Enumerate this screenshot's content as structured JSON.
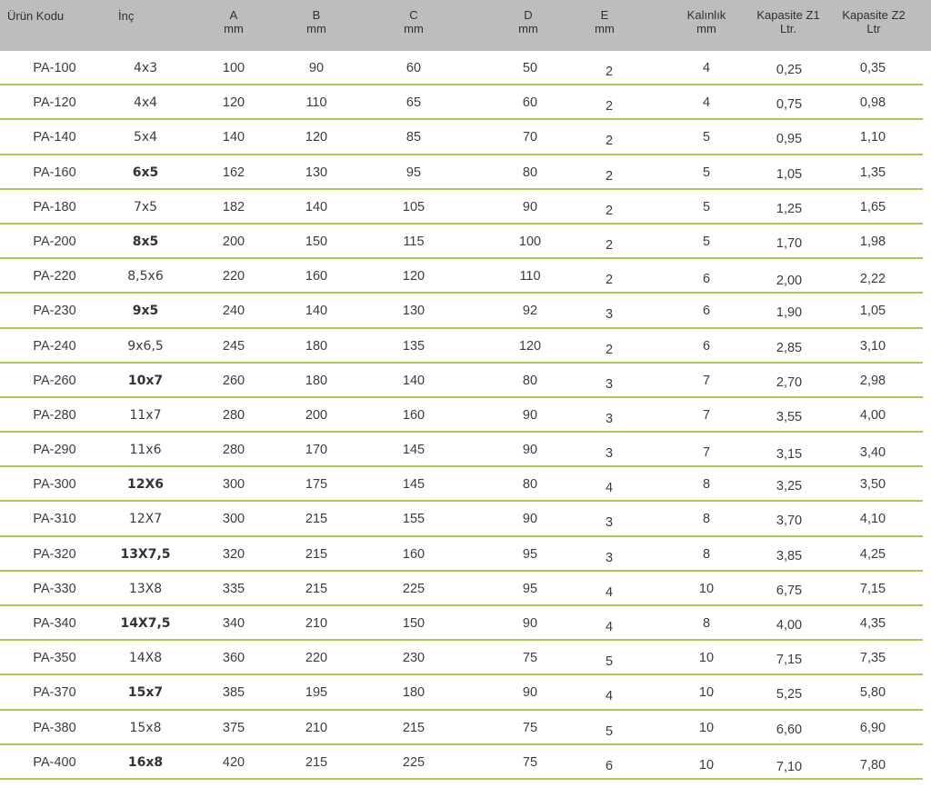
{
  "table": {
    "header": [
      {
        "key": "code",
        "l1": "Ürün Kodu",
        "l2": ""
      },
      {
        "key": "inc",
        "l1": "İnç",
        "l2": ""
      },
      {
        "key": "a",
        "l1": "A",
        "l2": "mm"
      },
      {
        "key": "b",
        "l1": "B",
        "l2": "mm"
      },
      {
        "key": "c",
        "l1": "C",
        "l2": "mm"
      },
      {
        "key": "d",
        "l1": "D",
        "l2": "mm"
      },
      {
        "key": "e",
        "l1": "E",
        "l2": "mm"
      },
      {
        "key": "kal",
        "l1": "Kalınlık",
        "l2": "mm"
      },
      {
        "key": "z1",
        "l1": "Kapasite Z1",
        "l2": "Ltr."
      },
      {
        "key": "z2",
        "l1": "Kapasite Z2",
        "l2": "Ltr"
      }
    ],
    "rows": [
      {
        "code": "PA-100",
        "inc": "4x3",
        "bold": false,
        "a": "100",
        "b": "90",
        "c": "60",
        "d": "50",
        "e": "2",
        "kal": "4",
        "z1": "0,25",
        "z2": "0,35"
      },
      {
        "code": "PA-120",
        "inc": "4x4",
        "bold": false,
        "a": "120",
        "b": "110",
        "c": "65",
        "d": "60",
        "e": "2",
        "kal": "4",
        "z1": "0,75",
        "z2": "0,98"
      },
      {
        "code": "PA-140",
        "inc": "5x4",
        "bold": false,
        "a": "140",
        "b": "120",
        "c": "85",
        "d": "70",
        "e": "2",
        "kal": "5",
        "z1": "0,95",
        "z2": "1,10"
      },
      {
        "code": "PA-160",
        "inc": "6x5",
        "bold": true,
        "a": "162",
        "b": "130",
        "c": "95",
        "d": "80",
        "e": "2",
        "kal": "5",
        "z1": "1,05",
        "z2": "1,35"
      },
      {
        "code": "PA-180",
        "inc": "7x5",
        "bold": false,
        "a": "182",
        "b": "140",
        "c": "105",
        "d": "90",
        "e": "2",
        "kal": "5",
        "z1": "1,25",
        "z2": "1,65"
      },
      {
        "code": "PA-200",
        "inc": "8x5",
        "bold": true,
        "a": "200",
        "b": "150",
        "c": "115",
        "d": "100",
        "e": "2",
        "kal": "5",
        "z1": "1,70",
        "z2": "1,98"
      },
      {
        "code": "PA-220",
        "inc": "8,5x6",
        "bold": false,
        "a": "220",
        "b": "160",
        "c": "120",
        "d": "110",
        "e": "2",
        "kal": "6",
        "z1": "2,00",
        "z2": "2,22"
      },
      {
        "code": "PA-230",
        "inc": "9x5",
        "bold": true,
        "a": "240",
        "b": "140",
        "c": "130",
        "d": "92",
        "e": "3",
        "kal": "6",
        "z1": "1,90",
        "z2": "1,05"
      },
      {
        "code": "PA-240",
        "inc": "9x6,5",
        "bold": false,
        "a": "245",
        "b": "180",
        "c": "135",
        "d": "120",
        "e": "2",
        "kal": "6",
        "z1": "2,85",
        "z2": "3,10"
      },
      {
        "code": "PA-260",
        "inc": "10x7",
        "bold": true,
        "a": "260",
        "b": "180",
        "c": "140",
        "d": "80",
        "e": "3",
        "kal": "7",
        "z1": "2,70",
        "z2": "2,98"
      },
      {
        "code": "PA-280",
        "inc": "11x7",
        "bold": false,
        "a": "280",
        "b": "200",
        "c": "160",
        "d": "90",
        "e": "3",
        "kal": "7",
        "z1": "3,55",
        "z2": "4,00"
      },
      {
        "code": "PA-290",
        "inc": "11x6",
        "bold": false,
        "a": "280",
        "b": "170",
        "c": "145",
        "d": "90",
        "e": "3",
        "kal": "7",
        "z1": "3,15",
        "z2": "3,40"
      },
      {
        "code": "PA-300",
        "inc": "12X6",
        "bold": true,
        "a": "300",
        "b": "175",
        "c": "145",
        "d": "80",
        "e": "4",
        "kal": "8",
        "z1": "3,25",
        "z2": "3,50"
      },
      {
        "code": "PA-310",
        "inc": "12X7",
        "bold": false,
        "a": "300",
        "b": "215",
        "c": "155",
        "d": "90",
        "e": "3",
        "kal": "8",
        "z1": "3,70",
        "z2": "4,10"
      },
      {
        "code": "PA-320",
        "inc": "13X7,5",
        "bold": true,
        "a": "320",
        "b": "215",
        "c": "160",
        "d": "95",
        "e": "3",
        "kal": "8",
        "z1": "3,85",
        "z2": "4,25"
      },
      {
        "code": "PA-330",
        "inc": "13X8",
        "bold": false,
        "a": "335",
        "b": "215",
        "c": "225",
        "d": "95",
        "e": "4",
        "kal": "10",
        "z1": "6,75",
        "z2": "7,15"
      },
      {
        "code": "PA-340",
        "inc": "14X7,5",
        "bold": true,
        "a": "340",
        "b": "210",
        "c": "150",
        "d": "90",
        "e": "4",
        "kal": "8",
        "z1": "4,00",
        "z2": "4,35"
      },
      {
        "code": "PA-350",
        "inc": "14X8",
        "bold": false,
        "a": "360",
        "b": "220",
        "c": "230",
        "d": "75",
        "e": "5",
        "kal": "10",
        "z1": "7,15",
        "z2": "7,35"
      },
      {
        "code": "PA-370",
        "inc": "15x7",
        "bold": true,
        "a": "385",
        "b": "195",
        "c": "180",
        "d": "90",
        "e": "4",
        "kal": "10",
        "z1": "5,25",
        "z2": "5,80"
      },
      {
        "code": "PA-380",
        "inc": "15x8",
        "bold": false,
        "a": "375",
        "b": "210",
        "c": "215",
        "d": "75",
        "e": "5",
        "kal": "10",
        "z1": "6,60",
        "z2": "6,90"
      },
      {
        "code": "PA-400",
        "inc": "16x8",
        "bold": true,
        "a": "420",
        "b": "215",
        "c": "225",
        "d": "75",
        "e": "6",
        "kal": "10",
        "z1": "7,10",
        "z2": "7,80"
      }
    ]
  }
}
